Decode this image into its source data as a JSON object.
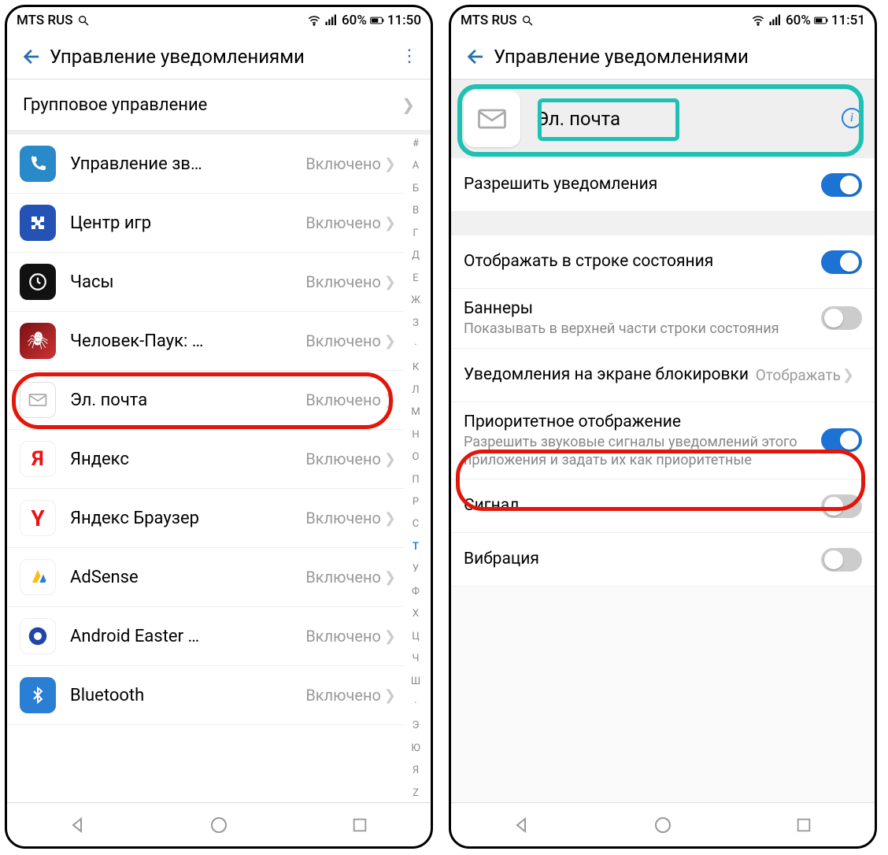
{
  "status": {
    "carrier": "MTS RUS",
    "battery": "60%",
    "time_left": "11:50",
    "time_right": "11:51"
  },
  "header": {
    "title": "Управление уведомлениями"
  },
  "group_row": "Групповое управление",
  "apps": [
    {
      "name": "Управление зв…",
      "status": "Включено"
    },
    {
      "name": "Центр игр",
      "status": "Включено"
    },
    {
      "name": "Часы",
      "status": "Включено"
    },
    {
      "name": "Человек-Паук: …",
      "status": "Включено"
    },
    {
      "name": "Эл. почта",
      "status": "Включено"
    },
    {
      "name": "Яндекс",
      "status": "Включено"
    },
    {
      "name": "Яндекс Браузер",
      "status": "Включено"
    },
    {
      "name": "AdSense",
      "status": "Включено"
    },
    {
      "name": "Android Easter …",
      "status": "Включено"
    },
    {
      "name": "Bluetooth",
      "status": "Включено"
    }
  ],
  "index_letters": [
    "#",
    "А",
    "Б",
    "В",
    "Г",
    "Д",
    "Е",
    "Ж",
    "З",
    "·",
    "К",
    "Л",
    "М",
    "Н",
    "О",
    "П",
    "Р",
    "С",
    "Т",
    "У",
    "Ф",
    "Х",
    "Ц",
    "Ч",
    "Ш",
    "·",
    "Э",
    "Ю",
    "Я",
    "Z"
  ],
  "index_active": "Т",
  "detail": {
    "app_name": "Эл. почта",
    "allow": "Разрешить уведомления",
    "statusbar_row": "Отображать в строке состояния",
    "banners_title": "Баннеры",
    "banners_sub": "Показывать в верхней части строки состояния",
    "lock_title": "Уведомления на экране блокировки",
    "lock_value": "Отображать",
    "priority_title": "Приоритетное отображение",
    "priority_sub": "Разрешить звуковые сигналы уведомлений этого приложения и задать их как приоритетные",
    "sound": "Сигнал",
    "vibration": "Вибрация"
  }
}
